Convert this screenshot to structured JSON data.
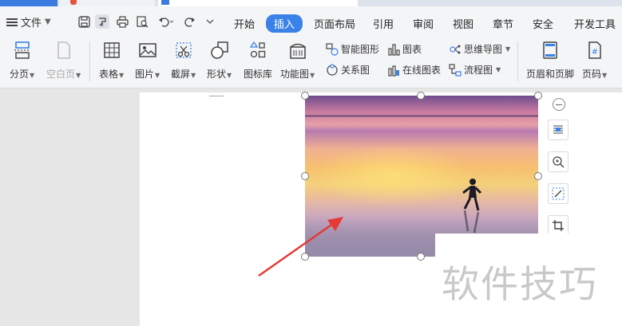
{
  "menubar": {
    "file_label": "文件",
    "tabs": [
      {
        "label": "开始"
      },
      {
        "label": "插入"
      },
      {
        "label": "页面布局"
      },
      {
        "label": "引用"
      },
      {
        "label": "审阅"
      },
      {
        "label": "视图"
      },
      {
        "label": "章节"
      },
      {
        "label": "安全"
      },
      {
        "label": "开发工具"
      }
    ]
  },
  "ribbon": {
    "page_break": "分页",
    "blank_page": "空白页",
    "table": "表格",
    "picture": "图片",
    "screenshot": "截屏",
    "shape": "形状",
    "icon_lib": "图标库",
    "function_chart": "功能图",
    "smart_art": "智能图形",
    "relation_chart": "关系图",
    "chart": "图表",
    "online_chart": "在线图表",
    "mind_map": "思维导图",
    "flowchart": "流程图",
    "header_footer": "页眉和页脚",
    "page_number": "页码"
  },
  "watermark": "软件技巧",
  "colors": {
    "accent": "#3b82e8",
    "annotation_arrow": "#e53935"
  }
}
